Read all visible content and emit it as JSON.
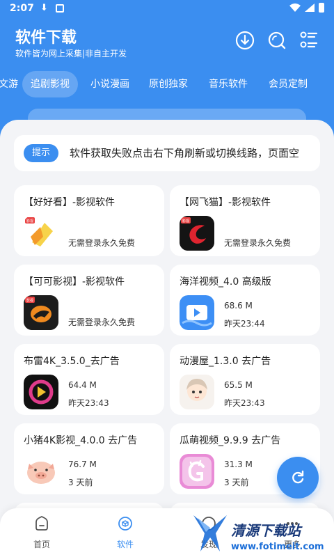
{
  "status_bar": {
    "time": "2:07"
  },
  "header": {
    "title": "软件下载",
    "subtitle": "软件皆为网上采集|非自主开发",
    "icons": [
      "download-icon",
      "search-icon",
      "list-icon"
    ]
  },
  "tabs": [
    {
      "label": "文游"
    },
    {
      "label": "追剧影视",
      "active": true
    },
    {
      "label": "小说漫画"
    },
    {
      "label": "原创独家"
    },
    {
      "label": "音乐软件"
    },
    {
      "label": "会员定制"
    }
  ],
  "notice": {
    "badge": "提示",
    "text": "软件获取失败点击右下角刷新或切换线路，页面空"
  },
  "cards": [
    {
      "title": "【好好看】-影视软件",
      "desc": "无需登录永久免费",
      "icon": "haohaokan-icon",
      "badge": "影视"
    },
    {
      "title": "【网飞猫】-影视软件",
      "desc": "无需登录永久免费",
      "icon": "wangfeimao-icon",
      "badge": "影视"
    },
    {
      "title": "【可可影视】-影视软件",
      "desc": "无需登录永久免费",
      "icon": "keke-icon",
      "badge": "影视"
    },
    {
      "title": "海洋视频_4.0 高级版",
      "size": "68.6 M",
      "date": "昨天23:44",
      "icon": "haiyang-icon"
    },
    {
      "title": "布雷4K_3.5.0_去广告",
      "size": "64.4 M",
      "date": "昨天23:43",
      "icon": "bulei-icon"
    },
    {
      "title": "动漫屋_1.3.0 去广告",
      "size": "65.5 M",
      "date": "昨天23:43",
      "icon": "dongmanwu-icon"
    },
    {
      "title": "小猪4K影视_4.0.0 去广告",
      "size": "76.7 M",
      "date": "3 天前",
      "icon": "xiaozhu-icon"
    },
    {
      "title": "瓜萌视频_9.9.9 去广告",
      "size": "31.3 M",
      "date": "3 天前",
      "icon": "guameng-icon"
    }
  ],
  "bottom_nav": [
    {
      "label": "首页",
      "icon": "home-icon"
    },
    {
      "label": "软件",
      "icon": "software-icon",
      "active": true
    },
    {
      "label": "发现",
      "icon": "discover-icon"
    },
    {
      "label": "更多",
      "icon": "more-icon"
    }
  ],
  "watermark": {
    "title": "清源下载站",
    "url": "www.fotimeit.com"
  },
  "colors": {
    "primary": "#3b8ef0",
    "sheet_bg": "#f3f4f7"
  }
}
